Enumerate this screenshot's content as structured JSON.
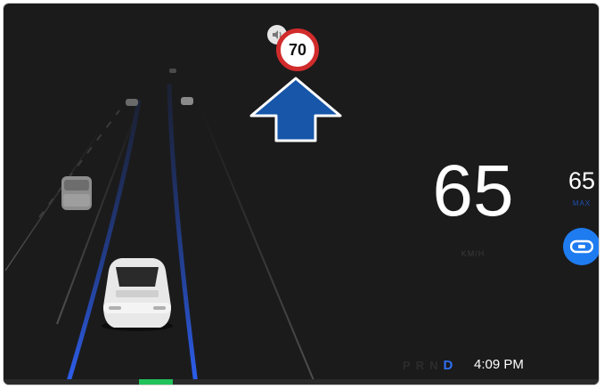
{
  "speed_limit_sign": {
    "value": "70",
    "icon": "speaker-icon"
  },
  "navigation": {
    "direction_icon": "arrow-up-icon",
    "color": "#1756a8"
  },
  "speedometer": {
    "current_speed": "65",
    "unit_label": "KM/H"
  },
  "cruise": {
    "set_speed": "65",
    "set_label": "MAX",
    "autosteer_icon": "steering-wheel-icon",
    "accent": "#1f7cf0"
  },
  "gear_selector": {
    "gears": [
      "P",
      "R",
      "N",
      "D"
    ],
    "active": "D"
  },
  "clock": {
    "time": "4:09 PM"
  },
  "colors": {
    "lane_lines": "#2d5ff0",
    "background": "#1b1b1c",
    "progress": "#21c25a"
  }
}
